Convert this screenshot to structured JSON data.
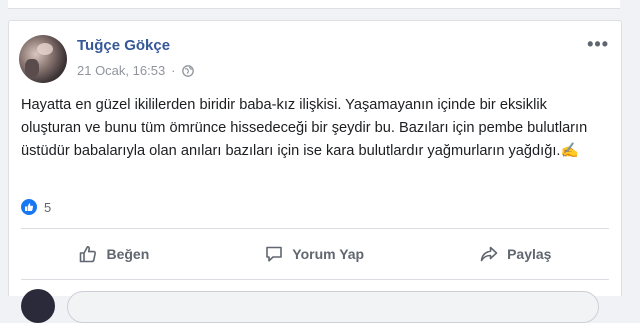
{
  "post": {
    "author": "Tuğçe Gökçe",
    "timestamp": "21 Ocak, 16:53",
    "privacy_icon": "globe-icon",
    "text": "Hayatta en güzel ikililerden biridir baba-kız ilişkisi. Yaşamayanın içinde bir eksiklik oluşturan ve bunu tüm ömrünce hissedeceği bir şeydir bu. Bazıları için pembe bulutların üstüdür babalarıyla olan anıları bazıları için ise kara bulutlardır yağmurların yağdığı.✍",
    "reaction_count": "5",
    "more_label": "•••"
  },
  "actions": {
    "like": "Beğen",
    "comment": "Yorum Yap",
    "share": "Paylaş"
  },
  "colors": {
    "author": "#365899",
    "like_badge": "#1877f2"
  }
}
